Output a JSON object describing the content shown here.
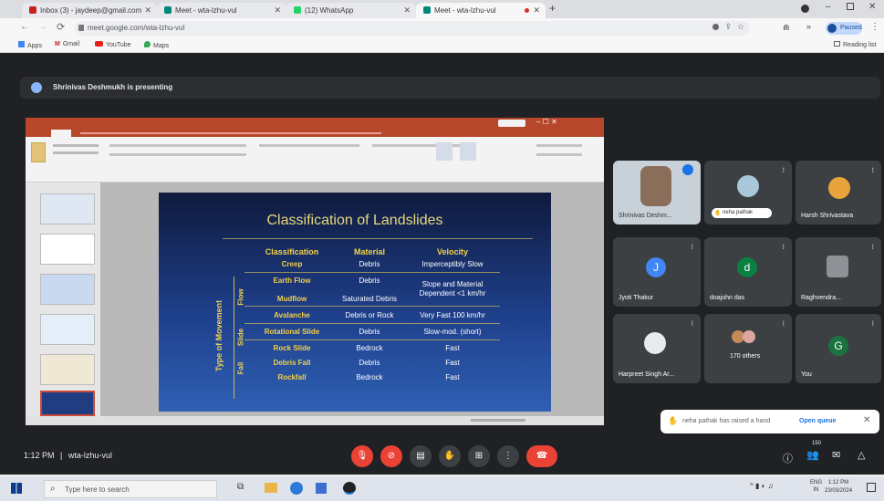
{
  "browser": {
    "tabs": [
      {
        "label": "Inbox (3) - jaydeep@gmail.com",
        "color": "#c5221f"
      },
      {
        "label": "Meet - wta-lzhu-vul",
        "color": "#00897b"
      },
      {
        "label": "(12) WhatsApp",
        "color": "#25d366"
      },
      {
        "label": "Meet - wta-lzhu-vul",
        "color": "#00897b"
      }
    ],
    "new_tab_label": "+",
    "url": "meet.google.com/wta-lzhu-vul",
    "bookmarks": [
      "Apps",
      "Gmail",
      "YouTube",
      "Maps"
    ],
    "reading_list": "Reading list",
    "profile_label": "Paused"
  },
  "meet": {
    "presenting_banner": "Shrinivas Deshmukh is presenting",
    "time_label": "1:12 PM",
    "separator": "|",
    "meeting_code": "wta-lzhu-vul",
    "toast": {
      "text": "neha pathak has raised a hand",
      "action": "Open queue",
      "close": "✕"
    },
    "people_count": "150",
    "participants": [
      {
        "name": "Shrinivas Deshm...",
        "initial": "",
        "color": "#5f6368"
      },
      {
        "name": "neha pathak",
        "initial": "",
        "color": "#a8c7d8"
      },
      {
        "name": "Harsh Shrivastava",
        "initial": "",
        "color": "#e8a33c"
      },
      {
        "name": "Jyoti Thakur",
        "initial": "J",
        "color": "#4285f4"
      },
      {
        "name": "doajohn das",
        "initial": "d",
        "color": "#0b8043"
      },
      {
        "name": "Raghvendra...",
        "initial": "",
        "color": "#5f6368"
      },
      {
        "name": "Harpreet Singh Ar...",
        "initial": "",
        "color": "#3c4043"
      },
      {
        "name": "170 others",
        "initial": "",
        "color": "#5f6368"
      },
      {
        "name": "You",
        "initial": "G",
        "color": "#1a7340"
      }
    ]
  },
  "slide": {
    "title": "Classification of Landslides",
    "side_label": "Type of Movement",
    "groups": [
      "Flow",
      "Slide",
      "Fall"
    ],
    "headers": [
      "Classification",
      "Material",
      "Velocity"
    ],
    "rows": [
      {
        "classification": "Creep",
        "material": "Debris",
        "velocity": "Imperceptibly Slow"
      },
      {
        "classification": "Earth Flow",
        "material": "Debris",
        "velocity": "Slope and Material"
      },
      {
        "classification": "",
        "material": "",
        "velocity": "Dependent <1 km/hr"
      },
      {
        "classification": "Mudflow",
        "material": "Saturated Debris",
        "velocity": ""
      },
      {
        "classification": "Avalanche",
        "material": "Debris or Rock",
        "velocity": "Very Fast 100 km/hr"
      },
      {
        "classification": "Rotational Slide",
        "material": "Debris",
        "velocity": "Slow-mod. (short)"
      },
      {
        "classification": "Rock Slide",
        "material": "Bedrock",
        "velocity": "Fast"
      },
      {
        "classification": "Debris Fall",
        "material": "Debris",
        "velocity": "Fast"
      },
      {
        "classification": "Rockfall",
        "material": "Bedrock",
        "velocity": "Fast"
      }
    ]
  },
  "taskbar": {
    "search_placeholder": "Type here to search",
    "lang": "ENG",
    "region": "IN",
    "clock_time": "1:12 PM",
    "clock_date": "23/03/2024"
  }
}
